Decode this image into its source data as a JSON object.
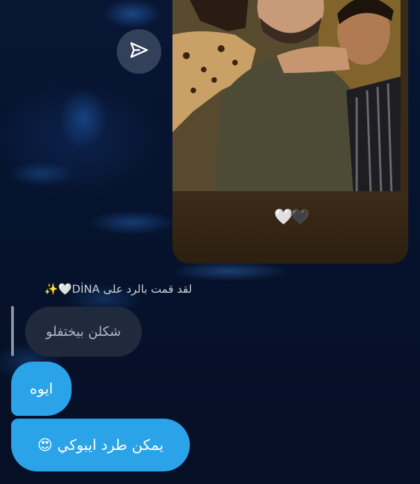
{
  "story": {
    "reaction_emoji": "🤍🖤"
  },
  "share": {
    "icon": "send-icon"
  },
  "reply": {
    "caption": "لقد قمت بالرد على DİNA🤍✨",
    "quoted_text": "شكلن بيختفلو"
  },
  "messages": [
    {
      "text": "ايوه"
    },
    {
      "text": "يمكن طرد ايبوكي 😍"
    }
  ],
  "colors": {
    "background": "#06132e",
    "sent_bubble": "#2aa3e8",
    "quoted_bubble": "#1f2a3d"
  }
}
